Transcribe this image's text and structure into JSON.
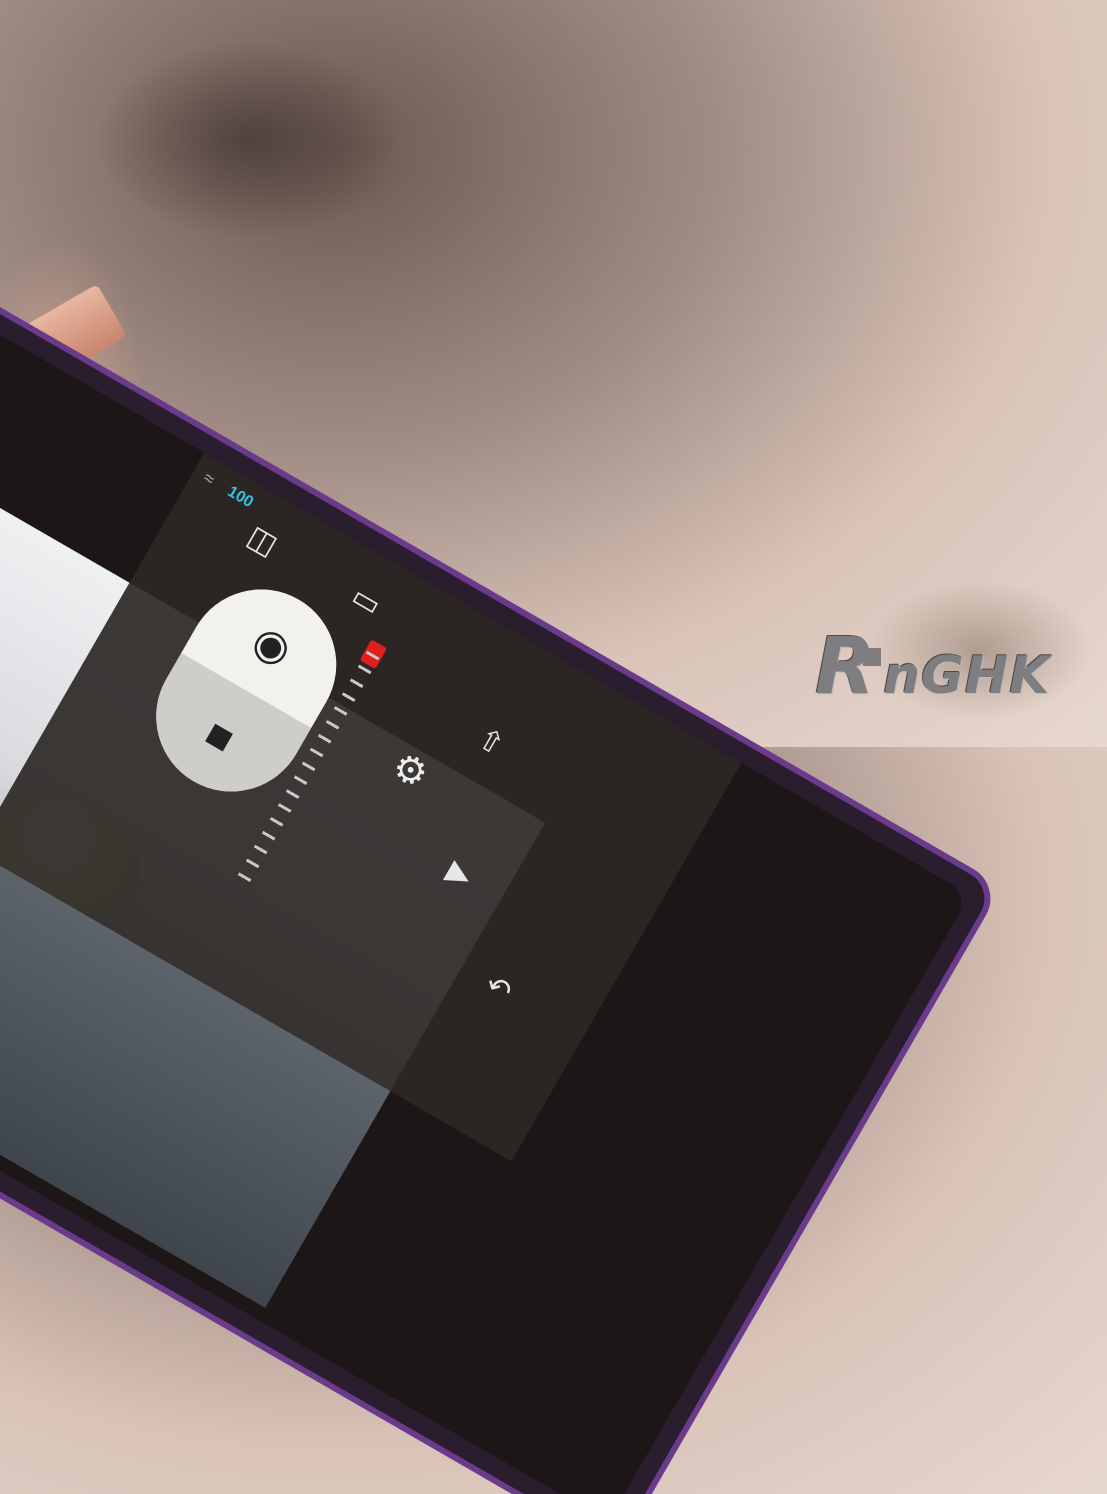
{
  "watermark": {
    "big": "R",
    "rest": "nGHK"
  },
  "status_bar": {
    "battery_label": "100"
  },
  "camera_menu": {
    "mode_photo_icon": "camera-icon",
    "mode_video_icon": "video-camera-icon",
    "settings_icon": "gear-icon",
    "gallery_icon": "play-icon",
    "back_icon": "back-arrow-icon",
    "switch_camera_icon": "switch-icon",
    "storage_icon": "sd-card-icon"
  },
  "colors": {
    "frame": "#6a3b8b",
    "battery": "#2ec6e6",
    "zoom_indicator": "#e0201e"
  }
}
